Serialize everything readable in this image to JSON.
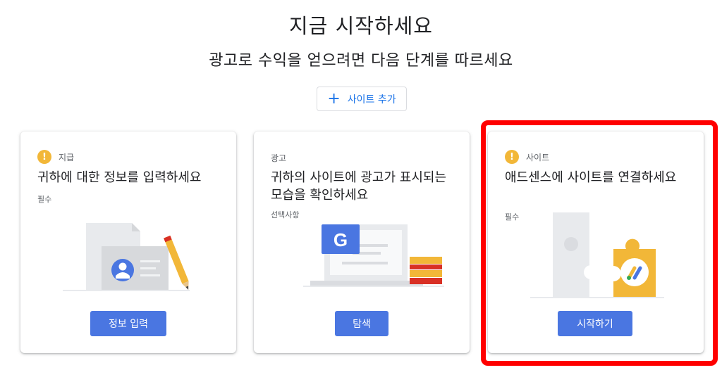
{
  "header": {
    "title": "지금 시작하세요",
    "subtitle": "광고로 수익을 얻으려면 다음 단계를 따르세요",
    "add_site_label": "사이트 추가"
  },
  "cards": [
    {
      "tag": "지급",
      "tag_has_warning": true,
      "title": "귀하에 대한 정보를 입력하세요",
      "note": "필수",
      "button_label": "정보 입력",
      "illustration": "id-card-document-pencil"
    },
    {
      "tag": "광고",
      "tag_has_warning": false,
      "title": "귀하의 사이트에 광고가 표시되는 모습을 확인하세요",
      "note": "선택사항",
      "button_label": "탐색",
      "illustration": "laptop-google-books"
    },
    {
      "tag": "사이트",
      "tag_has_warning": true,
      "title": "애드센스에 사이트를 연결하세요",
      "note": "필수",
      "button_label": "시작하기",
      "illustration": "puzzle-adsense"
    }
  ],
  "colors": {
    "primary_button": "#4a76e1",
    "link_blue": "#1a73e8",
    "warning": "#f2b738",
    "highlight_box": "#ff0000"
  }
}
